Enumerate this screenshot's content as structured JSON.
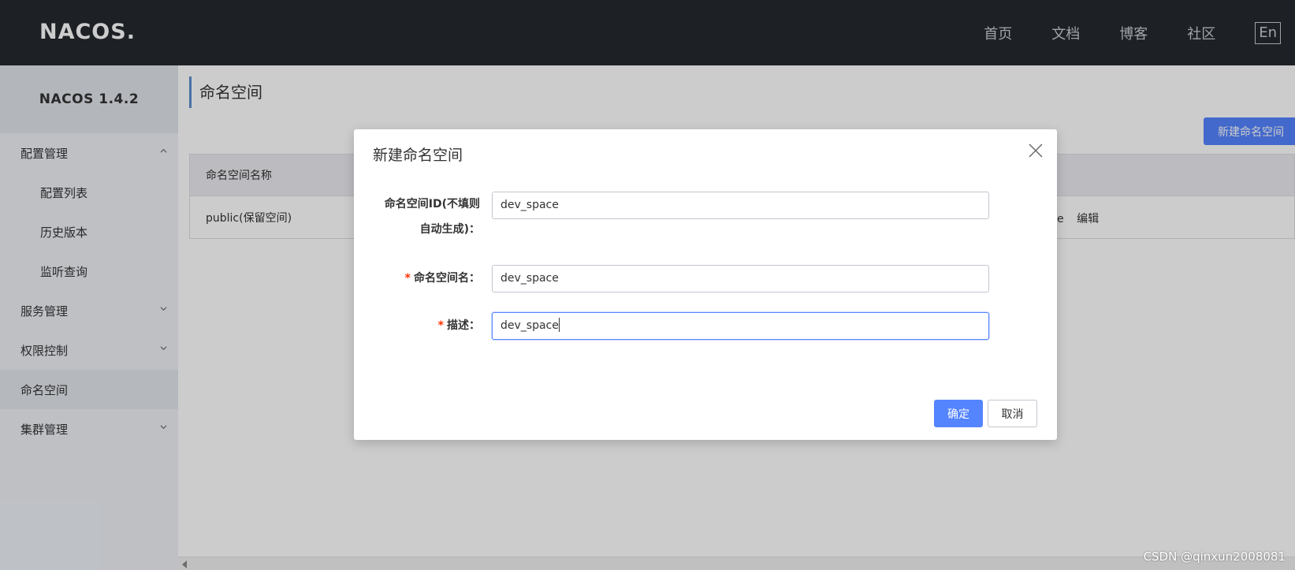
{
  "header": {
    "logo_text": "NACOS.",
    "nav": [
      "首页",
      "文档",
      "博客",
      "社区"
    ],
    "lang_button": "En"
  },
  "sidebar": {
    "version": "NACOS 1.4.2",
    "items": [
      {
        "label": "配置管理",
        "icon": "chevron-up-icon"
      },
      {
        "label": "配置列表"
      },
      {
        "label": "历史版本"
      },
      {
        "label": "监听查询"
      },
      {
        "label": "服务管理",
        "icon": "chevron-down-icon"
      },
      {
        "label": "权限控制",
        "icon": "chevron-down-icon"
      },
      {
        "label": "命名空间",
        "active": true
      },
      {
        "label": "集群管理",
        "icon": "chevron-down-icon"
      }
    ]
  },
  "main": {
    "title": "命名空间",
    "new_button": "新建命名空间",
    "table": {
      "header": "命名空间名称",
      "rows": [
        {
          "name": "public(保留空间)",
          "op_partial": "e",
          "op_edit": "编辑"
        }
      ]
    }
  },
  "dialog": {
    "title": "新建命名空间",
    "fields": [
      {
        "label_line1": "命名空间ID(不填则",
        "label_line2": "自动生成)：",
        "value": "dev_space",
        "required": false
      },
      {
        "label": "命名空间名：",
        "value": "dev_space",
        "required": true
      },
      {
        "label": "描述：",
        "value": "dev_space",
        "required": true,
        "focused": true
      }
    ],
    "required_mark": "*",
    "ok_button": "确定",
    "cancel_button": "取消"
  },
  "watermark": "CSDN @qinxun2008081",
  "colors": {
    "topbar": "#252a2f",
    "primary": "#5584ff",
    "required": "#ff3000"
  }
}
